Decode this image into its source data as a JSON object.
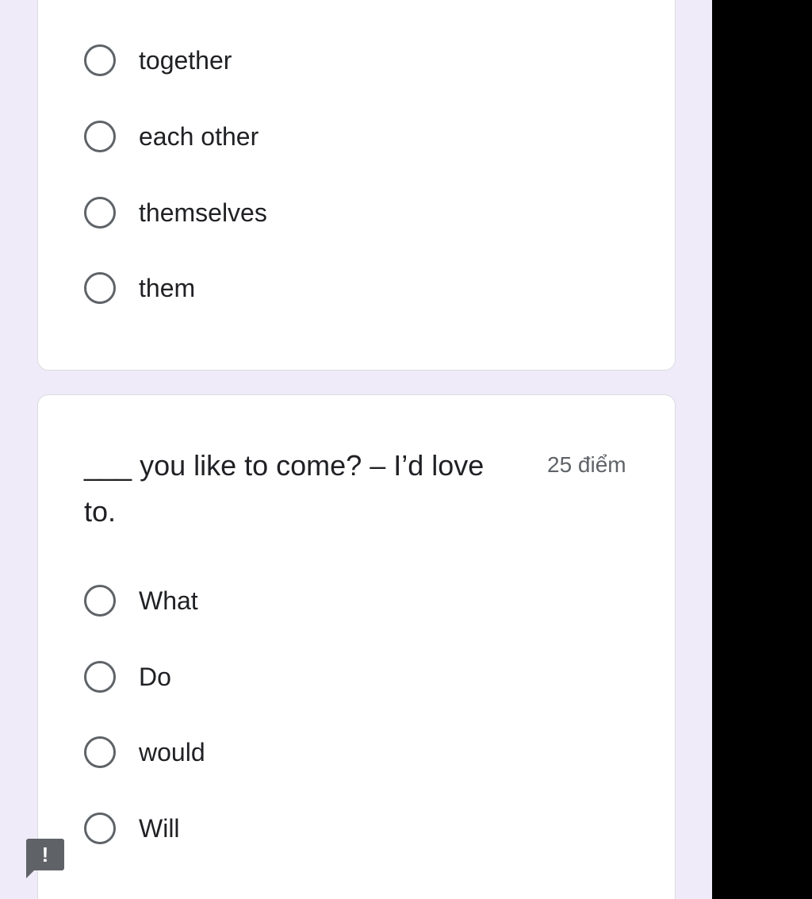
{
  "question_previous": {
    "options": [
      "together",
      "each other",
      "themselves",
      "them"
    ]
  },
  "question_current": {
    "title": "___ you like to come? – I’d love to.",
    "points": "25 điểm",
    "options": [
      "What",
      "Do",
      "would",
      "Will"
    ]
  },
  "feedback": {
    "icon": "!"
  }
}
